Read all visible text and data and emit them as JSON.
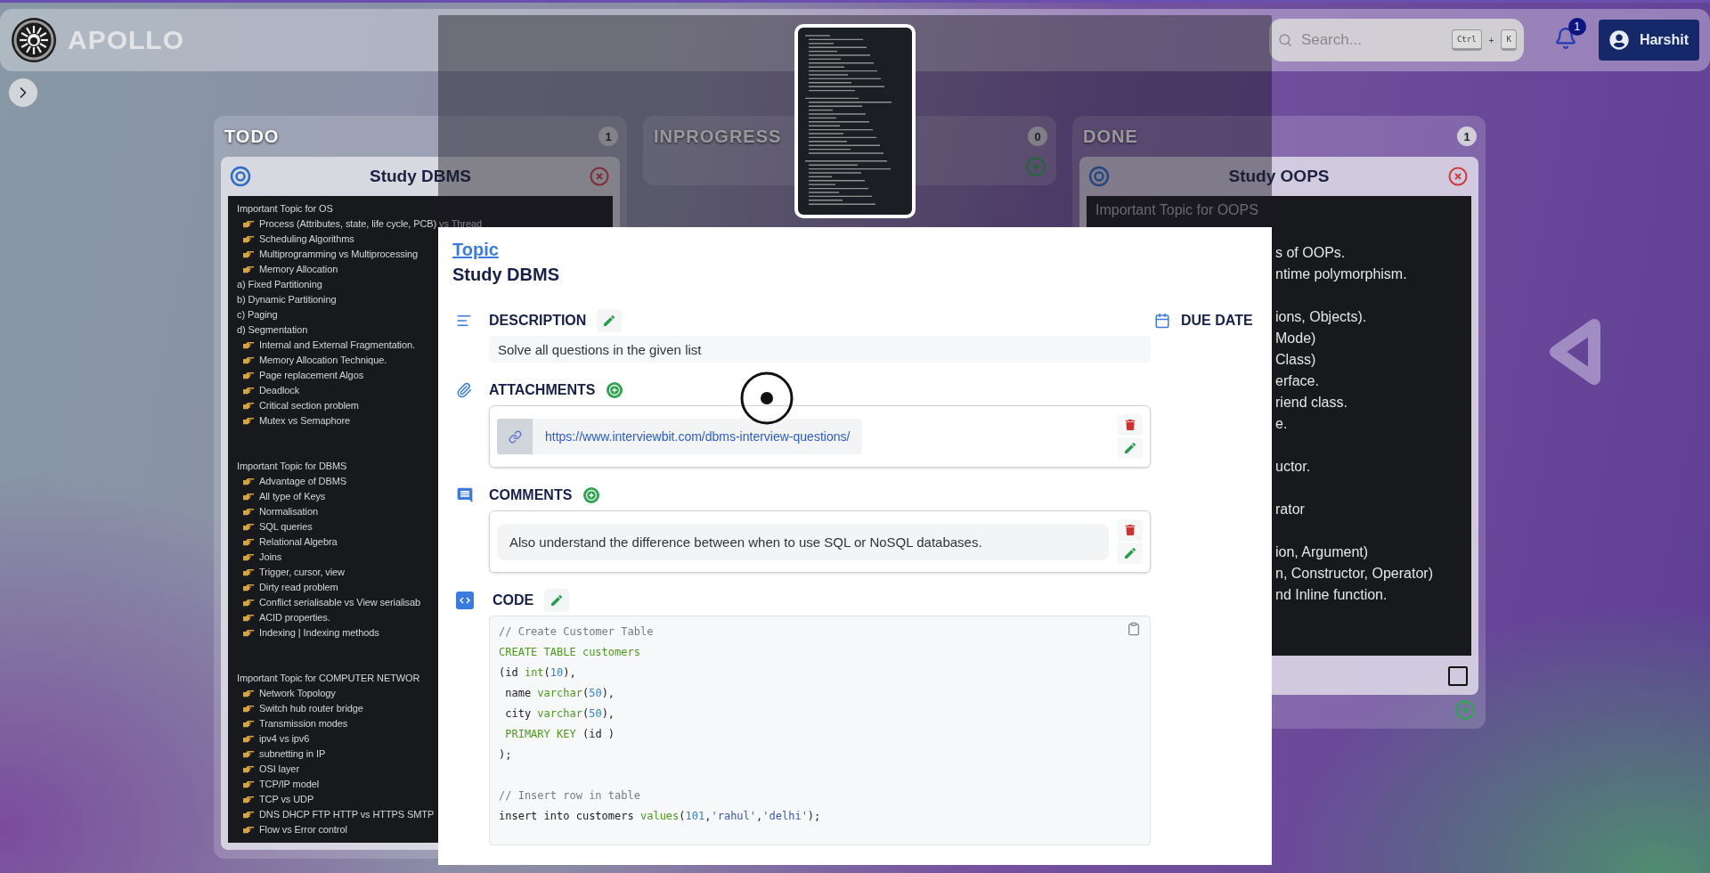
{
  "header": {
    "brand": "APOLLO",
    "search": {
      "placeholder": "Search...",
      "keys": [
        "Ctrl",
        "K"
      ],
      "joiner": "+"
    },
    "notifications": {
      "count": "1"
    },
    "user": {
      "name": "Harshit"
    }
  },
  "columns": [
    {
      "title": "TODO",
      "count": "1",
      "add_button": false,
      "cards": [
        {
          "title": "Study DBMS",
          "kind": "outline",
          "sections": [
            {
              "heading": "Important Topic for OS",
              "lines": [
                {
                  "kind": "bullet",
                  "text": "Process (Attributes, state, life cycle, PCB) vs Thread"
                },
                {
                  "kind": "bullet",
                  "text": "Scheduling Algorithms"
                },
                {
                  "kind": "bullet",
                  "text": "Multiprogramming vs Multiprocessing"
                },
                {
                  "kind": "bullet",
                  "text": "Memory Allocation"
                },
                {
                  "kind": "plain",
                  "text": "a) Fixed Partitioning"
                },
                {
                  "kind": "plain",
                  "text": "b) Dynamic Partitioning"
                },
                {
                  "kind": "plain",
                  "text": "c) Paging"
                },
                {
                  "kind": "plain",
                  "text": "d) Segmentation"
                },
                {
                  "kind": "bullet",
                  "text": "Internal and External Fragmentation."
                },
                {
                  "kind": "bullet",
                  "text": "Memory Allocation Technique."
                },
                {
                  "kind": "bullet",
                  "text": "Page replacement Algos"
                },
                {
                  "kind": "bullet",
                  "text": "Deadlock"
                },
                {
                  "kind": "bullet",
                  "text": "Critical section problem"
                },
                {
                  "kind": "bullet",
                  "text": "Mutex vs Semaphore"
                }
              ]
            },
            {
              "heading": "Important Topic for DBMS",
              "lines": [
                {
                  "kind": "bullet",
                  "text": "Advantage of DBMS"
                },
                {
                  "kind": "bullet",
                  "text": "All type of Keys"
                },
                {
                  "kind": "bullet",
                  "text": "Normalisation"
                },
                {
                  "kind": "bullet",
                  "text": "SQL queries"
                },
                {
                  "kind": "bullet",
                  "text": "Relational Algebra"
                },
                {
                  "kind": "bullet",
                  "text": "Joins"
                },
                {
                  "kind": "bullet",
                  "text": "Trigger, cursor, view"
                },
                {
                  "kind": "bullet",
                  "text": "Dirty read problem"
                },
                {
                  "kind": "bullet",
                  "text": "Conflict serialisable vs View serialisab"
                },
                {
                  "kind": "bullet",
                  "text": "ACID properties."
                },
                {
                  "kind": "bullet",
                  "text": "Indexing | Indexing methods"
                }
              ]
            },
            {
              "heading": "Important Topic for COMPUTER NETWOR",
              "lines": [
                {
                  "kind": "bullet",
                  "text": "Network Topology"
                },
                {
                  "kind": "bullet",
                  "text": "Switch hub router bridge"
                },
                {
                  "kind": "bullet",
                  "text": "Transmission modes"
                },
                {
                  "kind": "bullet",
                  "text": "ipv4 vs ipv6"
                },
                {
                  "kind": "bullet",
                  "text": "subnetting in IP"
                },
                {
                  "kind": "bullet",
                  "text": "OSI layer"
                },
                {
                  "kind": "bullet",
                  "text": "TCP/IP model"
                },
                {
                  "kind": "bullet",
                  "text": "TCP vs UDP"
                },
                {
                  "kind": "bullet",
                  "text": "DNS DHCP FTP HTTP vs HTTPS SMTP"
                },
                {
                  "kind": "bullet",
                  "text": "Flow vs Error control"
                }
              ]
            }
          ]
        }
      ]
    },
    {
      "title": "INPROGRESS",
      "count": "0",
      "add_button": true
    },
    {
      "title": "DONE",
      "count": "1",
      "add_button": true,
      "cards": [
        {
          "title": "Study OOPS",
          "kind": "fragments",
          "checked": false,
          "heading": "Important Topic for OOPS",
          "blocks": [
            [
              "s of OOPs.",
              "ntime polymorphism."
            ],
            [
              "ions, Objects).",
              "Mode)",
              "Class)",
              "erface.",
              "riend class.",
              "e."
            ],
            [
              "uctor."
            ],
            [
              "rator"
            ],
            [
              "ion, Argument)",
              "n, Constructor, Operator)",
              "nd Inline function."
            ]
          ]
        }
      ]
    }
  ],
  "modal": {
    "link": "Topic",
    "title": "Study DBMS",
    "description": {
      "label": "DESCRIPTION",
      "value": "Solve all questions in the given list"
    },
    "attachments": {
      "label": "ATTACHMENTS",
      "links": [
        "https://www.interviewbit.com/dbms-interview-questions/"
      ]
    },
    "comments": {
      "label": "COMMENTS",
      "items": [
        "Also understand the difference between when to use SQL or NoSQL databases."
      ]
    },
    "code": {
      "label": "CODE",
      "blocks": [
        [
          [
            {
              "kind": "comment",
              "text": "// Create Customer Table"
            }
          ],
          [
            {
              "kind": "keyword",
              "text": "CREATE TABLE customers"
            }
          ],
          [
            {
              "kind": "plain",
              "text": "(id "
            },
            {
              "kind": "keyword",
              "text": "int"
            },
            {
              "kind": "plain",
              "text": "("
            },
            {
              "kind": "number",
              "text": "10"
            },
            {
              "kind": "plain",
              "text": "),"
            }
          ],
          [
            {
              "kind": "plain",
              "text": " name "
            },
            {
              "kind": "keyword",
              "text": "varchar"
            },
            {
              "kind": "plain",
              "text": "("
            },
            {
              "kind": "number",
              "text": "50"
            },
            {
              "kind": "plain",
              "text": "),"
            }
          ],
          [
            {
              "kind": "plain",
              "text": " city "
            },
            {
              "kind": "keyword",
              "text": "varchar"
            },
            {
              "kind": "plain",
              "text": "("
            },
            {
              "kind": "number",
              "text": "50"
            },
            {
              "kind": "plain",
              "text": "),"
            }
          ],
          [
            {
              "kind": "keyword",
              "text": " PRIMARY KEY"
            },
            {
              "kind": "plain",
              "text": " (id )"
            }
          ],
          [
            {
              "kind": "plain",
              "text": ");"
            }
          ]
        ],
        [
          [
            {
              "kind": "comment",
              "text": "// Insert row in table"
            }
          ],
          [
            {
              "kind": "plain",
              "text": "insert into customers "
            },
            {
              "kind": "keyword",
              "text": "values"
            },
            {
              "kind": "plain",
              "text": "("
            },
            {
              "kind": "number",
              "text": "101"
            },
            {
              "kind": "plain",
              "text": ","
            },
            {
              "kind": "string",
              "text": "'rahul'"
            },
            {
              "kind": "plain",
              "text": ","
            },
            {
              "kind": "string",
              "text": "'delhi'"
            },
            {
              "kind": "plain",
              "text": ");"
            }
          ]
        ]
      ]
    },
    "due_date": {
      "label": "DUE DATE"
    }
  }
}
